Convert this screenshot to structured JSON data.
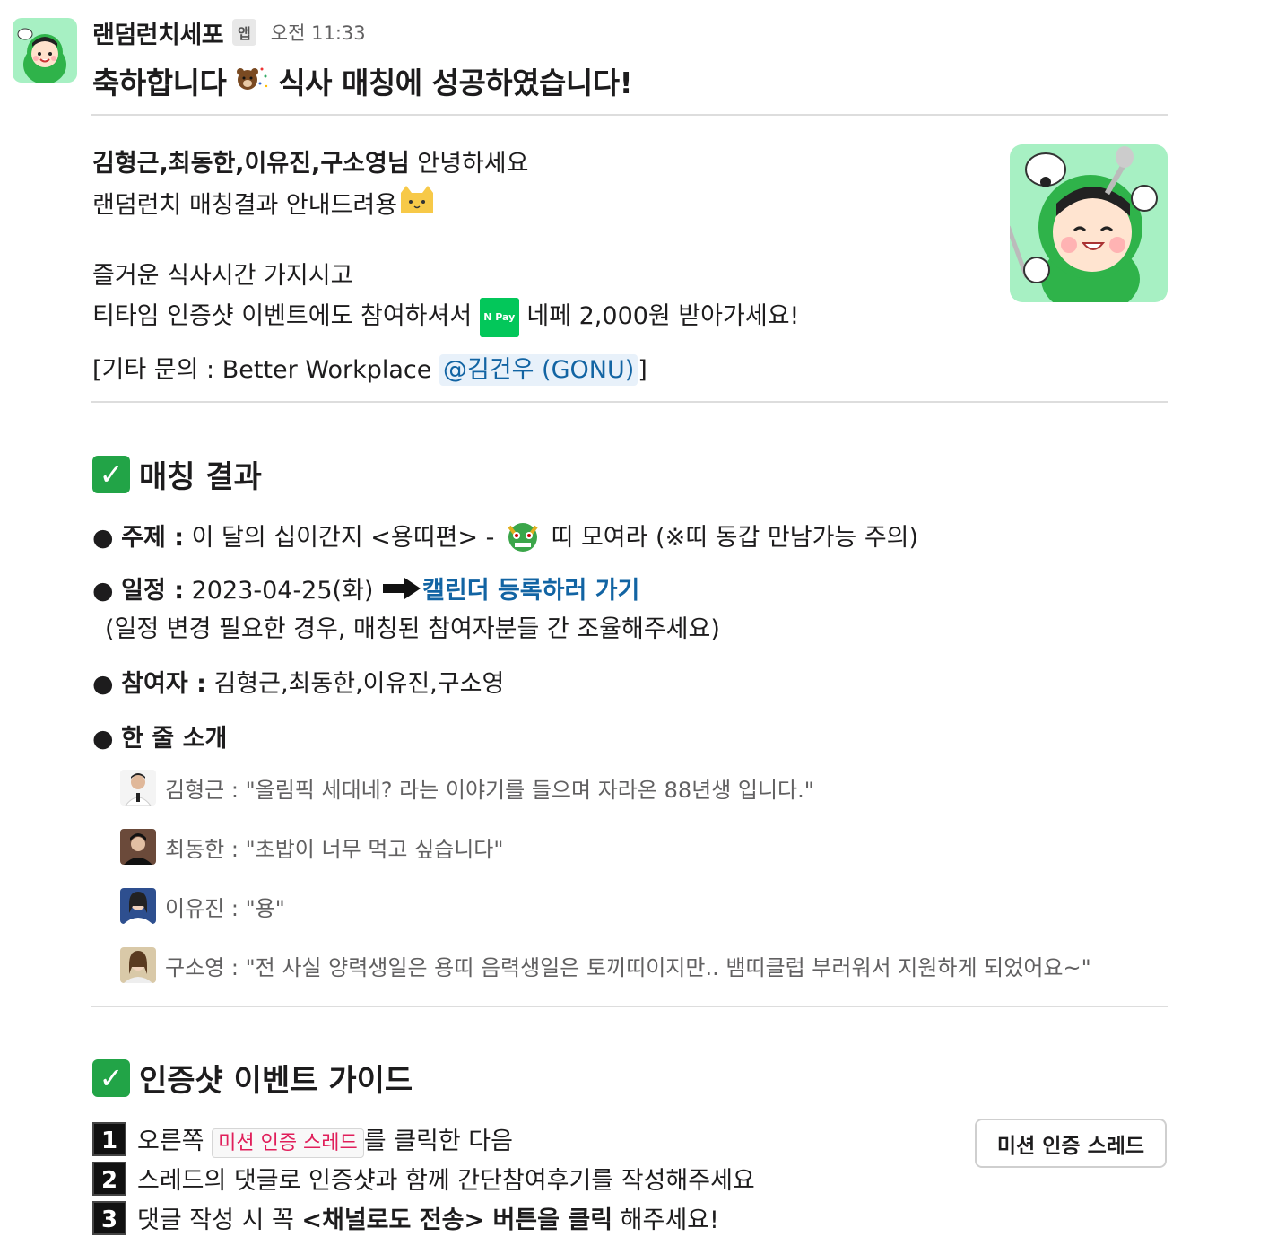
{
  "header": {
    "sender": "랜덤런치세포",
    "app_badge": "앱",
    "time": "오전 11:33"
  },
  "headline": {
    "part1": "축하합니다",
    "part2": "식사 매칭에 성공하였습니다!"
  },
  "intro": {
    "names_bold": "김형근,최동한,이유진,구소영님",
    "greeting": " 안녕하세요",
    "line2": "랜덤런치 매칭결과 안내드려용",
    "line3": "즐거운 식사시간 가지시고",
    "line4_a": "티타임 인증샷 이벤트에도 참여하셔서 ",
    "npay_label": "N Pay",
    "line4_b": " 네페 2,000원 받아가세요!",
    "line5_a": "[기타 문의 : Better Workplace ",
    "mention": "@김건우 (GONU)",
    "line5_b": "]"
  },
  "match": {
    "title": "매칭 결과",
    "topic_label": "주제 :",
    "topic_a": " 이 달의 십이간지 <용띠편> - ",
    "topic_b": " 띠 모여라 (※띠 동갑 만남가능 주의)",
    "schedule_label": "일정 :",
    "schedule_value": " 2023-04-25(화) ",
    "calendar_link": "캘린더 등록하러 가기",
    "schedule_note": "(일정 변경 필요한 경우, 매칭된 참여자분들 간 조율해주세요)",
    "participants_label": "참여자 :",
    "participants_value": " 김형근,최동한,이유진,구소영",
    "oneline_label": "한 줄 소개",
    "intros": [
      "김형근 : \"올림픽 세대네? 라는 이야기를 들으며 자라온 88년생 입니다.\"",
      "최동한 : \"초밥이 너무 먹고 싶습니다\"",
      "이유진 : \"용\"",
      "구소영 : \"전 사실 양력생일은 용띠 음력생일은 토끼띠이지만.. 뱀띠클럽 부러워서 지원하게 되었어요~\""
    ]
  },
  "guide": {
    "title": "인증샷 이벤트 가이드",
    "step1_num": "1",
    "step1_a": "오른쪽 ",
    "step1_code": "미션 인증 스레드",
    "step1_b": "를 클릭한 다음",
    "step2_num": "2",
    "step2": "스레드의 댓글로 인증샷과 함께 간단참여후기를 작성해주세요",
    "step3_num": "3",
    "step3_a": "댓글 작성 시 꼭 ",
    "step3_bold": "<채널로도 전송> 버튼을 클릭",
    "step3_b": " 해주세요!",
    "button_label": "미션 인증 스레드"
  },
  "colors": {
    "accent_link": "#1264a3",
    "check_green": "#22a447",
    "mascot_bg": "#a7f0c3",
    "code_red": "#e01e5a"
  }
}
